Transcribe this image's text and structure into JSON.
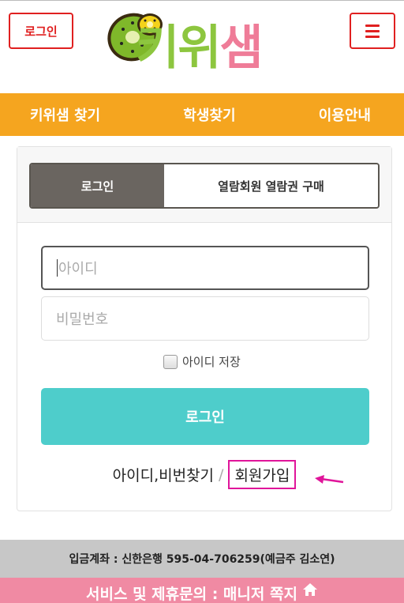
{
  "header": {
    "login_label": "로그인",
    "logo_part1": "키위",
    "logo_part2": "샘",
    "menu_icon": "hamburger-icon"
  },
  "nav": {
    "items": [
      {
        "label": "키위샘 찾기"
      },
      {
        "label": "학생찾기"
      },
      {
        "label": "이용안내"
      }
    ]
  },
  "tabs": {
    "login": "로그인",
    "purchase": "열람회원 열람권 구매"
  },
  "form": {
    "id_placeholder": "아이디",
    "pw_placeholder": "비밀번호",
    "save_id_label": "아이디 저장",
    "login_button": "로그인"
  },
  "links": {
    "find": "아이디,비번찾기",
    "separator": "/",
    "signup": "회원가입"
  },
  "footer": {
    "bank_info": "입금계좌 : 신한은행 595-04-706259(예금주 김소연)",
    "contact": "서비스 및 제휴문의 : 매니저 쪽지",
    "contact_icon": "home-icon"
  },
  "colors": {
    "brand_green": "#8dc63f",
    "brand_pink": "#ef7c98",
    "nav_orange": "#f5a51f",
    "login_teal": "#4ecdcb",
    "alert_red": "#e02020"
  }
}
